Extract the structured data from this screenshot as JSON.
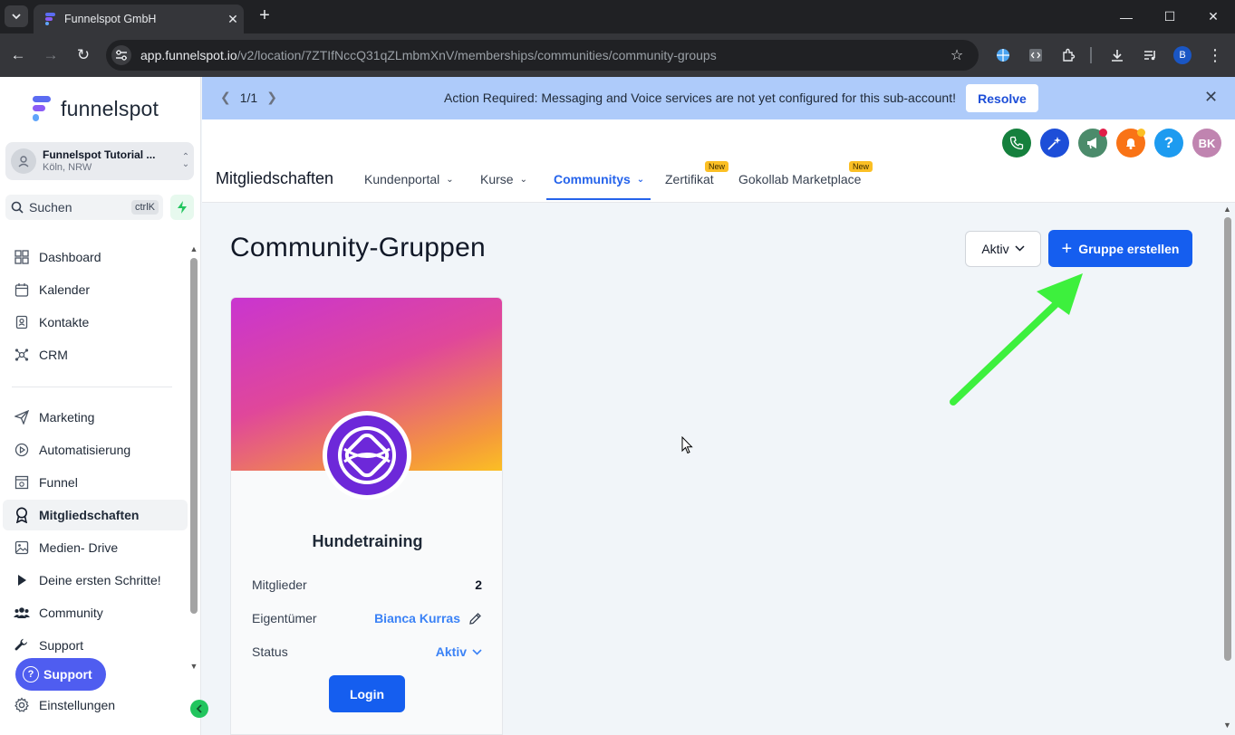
{
  "browser": {
    "tab_title": "Funnelspot GmbH",
    "url_host": "app.funnelspot.io",
    "url_path": "/v2/location/7ZTIfNccQ31qZLmbmXnV/memberships/communities/community-groups",
    "profile_initial": "B"
  },
  "sidebar": {
    "brand": "funnelspot",
    "account_name": "Funnelspot Tutorial ...",
    "account_location": "Köln, NRW",
    "search_label": "Suchen",
    "search_shortcut": "ctrlK",
    "items": [
      {
        "label": "Dashboard",
        "icon": "dashboard-icon"
      },
      {
        "label": "Kalender",
        "icon": "calendar-icon"
      },
      {
        "label": "Kontakte",
        "icon": "contacts-icon"
      },
      {
        "label": "CRM",
        "icon": "crm-icon"
      },
      {
        "label": "Marketing",
        "icon": "send-icon"
      },
      {
        "label": "Automatisierung",
        "icon": "automation-icon"
      },
      {
        "label": "Funnel",
        "icon": "funnel-icon"
      },
      {
        "label": "Mitgliedschaften",
        "icon": "award-icon"
      },
      {
        "label": "Medien- Drive",
        "icon": "image-icon"
      },
      {
        "label": "Deine ersten Schritte!",
        "icon": "play-icon"
      },
      {
        "label": "Community",
        "icon": "users-icon"
      },
      {
        "label": "Support",
        "icon": "wrench-icon"
      },
      {
        "label": "Einstellungen",
        "icon": "gear-icon"
      }
    ],
    "support_button": "Support"
  },
  "banner": {
    "pager": "1/1",
    "message": "Action Required: Messaging and Voice services are not yet configured for this sub-account!",
    "resolve_label": "Resolve"
  },
  "header": {
    "user_initials": "BK",
    "help_label": "?",
    "section_title": "Mitgliedschaften",
    "tabs": [
      {
        "label": "Kundenportal"
      },
      {
        "label": "Kurse"
      },
      {
        "label": "Communitys"
      },
      {
        "label": "Zertifikat",
        "badge": "New"
      },
      {
        "label": "Gokollab Marketplace",
        "badge": "New"
      }
    ]
  },
  "main": {
    "title": "Community-Gruppen",
    "status_filter": "Aktiv",
    "create_button": "Gruppe erstellen",
    "group_card": {
      "name": "Hundetraining",
      "members_label": "Mitglieder",
      "members_value": "2",
      "owner_label": "Eigentümer",
      "owner_value": "Bianca Kurras",
      "status_label": "Status",
      "status_value": "Aktiv",
      "login_label": "Login"
    }
  },
  "colors": {
    "primary": "#155eef",
    "banner_bg": "#aecbfa",
    "annotation_arrow": "#3df03d",
    "emblem": "#6d28d9"
  }
}
